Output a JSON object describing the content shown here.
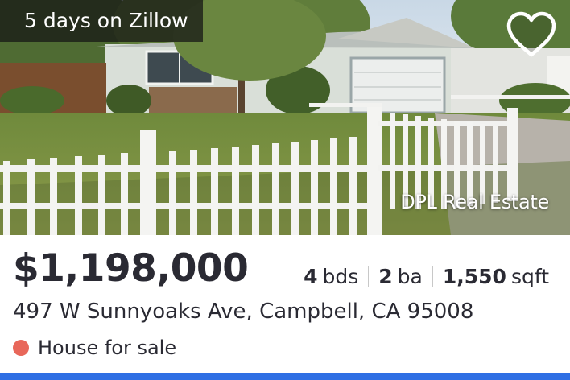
{
  "listing": {
    "days_on_site": "5 days on Zillow",
    "brokerage": "DPL Real Estate",
    "price": "$1,198,000",
    "beds_value": "4",
    "beds_unit": "bds",
    "baths_value": "2",
    "baths_unit": "ba",
    "sqft_value": "1,550",
    "sqft_unit": "sqft",
    "address": "497 W Sunnyoaks Ave, Campbell, CA 95008",
    "status": "House for sale"
  },
  "icons": {
    "favorite": "heart-outline-icon",
    "status": "status-dot-icon"
  },
  "colors": {
    "status_dot": "#e8675a",
    "accent_bar": "#2f6fe4",
    "text": "#2a2a33"
  }
}
